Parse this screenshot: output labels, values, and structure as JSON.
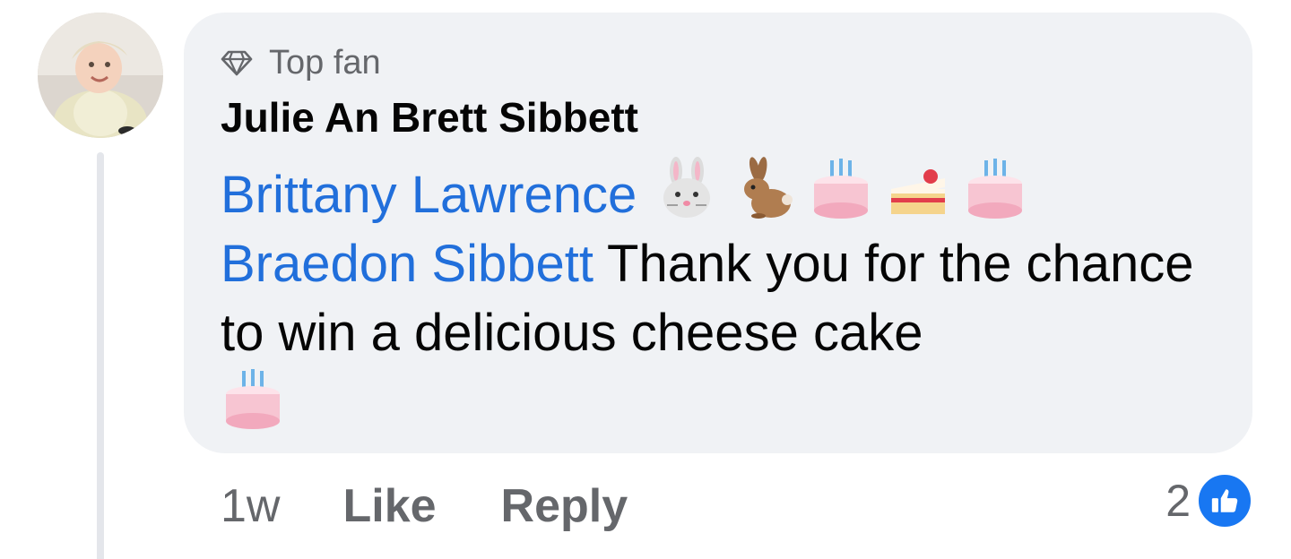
{
  "comment": {
    "badge": "Top fan",
    "badge_icon": "diamond-icon",
    "author": "Julie An Brett Sibbett",
    "mention_1": "Brittany Lawrence",
    "mention_2": "Braedon Sibbett",
    "text_part_1": " Thank you for the chance to win a delicious cheese cake",
    "emojis_line_1": [
      "rabbit-face-emoji",
      "rabbit-emoji",
      "birthday-cake-emoji",
      "shortcake-emoji",
      "birthday-cake-emoji"
    ],
    "emoji_end": "birthday-cake-emoji"
  },
  "actions": {
    "time": "1w",
    "like_label": "Like",
    "reply_label": "Reply"
  },
  "reactions": {
    "count": "2",
    "icon": "thumbs-up-icon",
    "color": "#1877f2"
  },
  "colors": {
    "bubble": "#f0f2f5",
    "mention": "#216fdb",
    "secondary_text": "#65676b"
  }
}
